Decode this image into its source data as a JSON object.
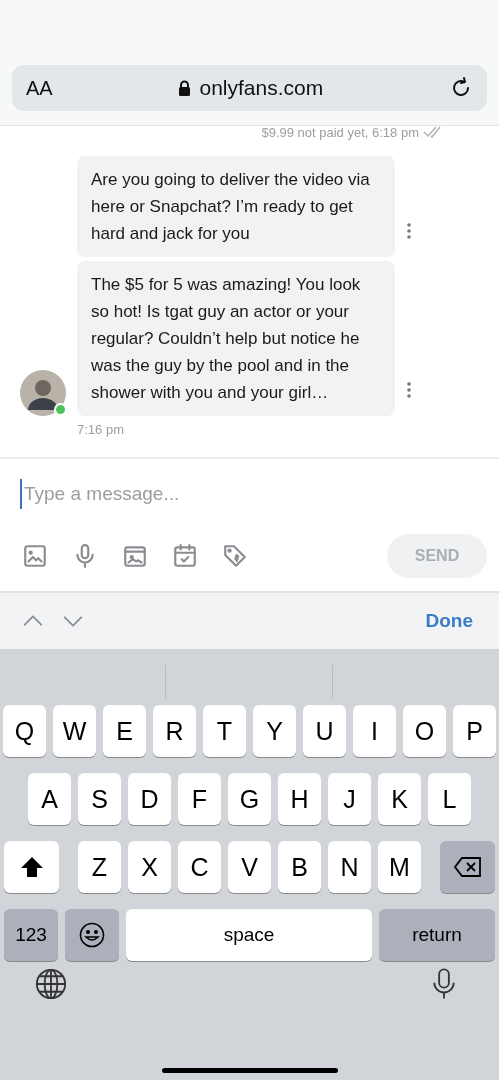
{
  "browser_bar": {
    "text_size_button": "AA",
    "url": "onlyfans.com"
  },
  "receipt": "$9.99 not paid yet, 6:18 pm",
  "messages": [
    {
      "text": "Are you going to deliver the video via here or Snapchat? I’m ready to get hard and jack for you"
    },
    {
      "text": "The $5 for 5 was amazing! You look so hot! Is tgat guy an actor or your regular? Couldn’t help but notice he was the guy by the pool and in the shower with you and your girl…"
    }
  ],
  "sender": {
    "online": true
  },
  "message_time": "7:16 pm",
  "composer": {
    "placeholder": "Type a message...",
    "send": {
      "label": "SEND",
      "disabled": true
    }
  },
  "accessory_bar": {
    "done": "Done"
  },
  "keyboard": {
    "rows": [
      [
        "Q",
        "W",
        "E",
        "R",
        "T",
        "Y",
        "U",
        "I",
        "O",
        "P"
      ],
      [
        "A",
        "S",
        "D",
        "F",
        "G",
        "H",
        "J",
        "K",
        "L"
      ],
      [
        "Z",
        "X",
        "C",
        "V",
        "B",
        "N",
        "M"
      ]
    ],
    "numbers_key": "123",
    "space_key": "space",
    "return_key": "return"
  }
}
